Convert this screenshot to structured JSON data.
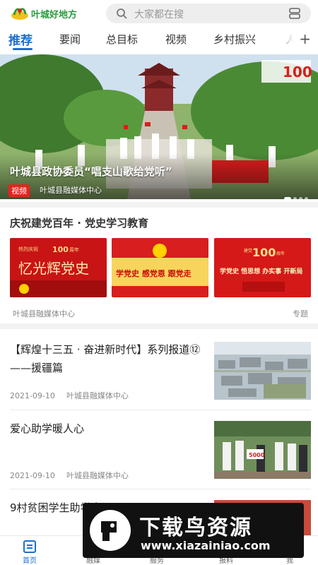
{
  "header": {
    "app_title": "叶城好地方",
    "search_placeholder": "大家都在搜"
  },
  "tabs": [
    {
      "label": "推荐",
      "active": true
    },
    {
      "label": "要闻"
    },
    {
      "label": "总目标"
    },
    {
      "label": "视频"
    },
    {
      "label": "乡村振兴"
    },
    {
      "label": "人"
    }
  ],
  "hero": {
    "caption": "叶城县政协委员“唱支山歌给党听”",
    "tag": "视频",
    "source": "叶城县融媒体中心",
    "badge_number": "100"
  },
  "special": {
    "title": "庆祝建党百年 · 党史学习教育",
    "source": "叶城县融媒体中心",
    "tag": "专题",
    "banners": [
      {
        "text": "忆光辉党史",
        "small": "热烈庆祝",
        "number": "100",
        "unit": "周年"
      },
      {
        "text": "学党史 感党恩 跟党走"
      },
      {
        "text": "学党史 悟思想 办实事 开新局",
        "small": "建党",
        "number": "100",
        "unit": "周年"
      }
    ]
  },
  "news": [
    {
      "title": "【辉煌十三五 · 奋进新时代】系列报道⑫——援疆篇",
      "date": "2021-09-10",
      "source": "叶城县融媒体中心"
    },
    {
      "title": "爱心助学暖人心",
      "date": "2021-09-10",
      "source": "叶城县融媒体中心",
      "banner_text": "5000"
    },
    {
      "title": "9村贫困学生助学金",
      "date": "",
      "source": ""
    }
  ],
  "bottom_nav": [
    {
      "label": "首页",
      "active": true
    },
    {
      "label": "融媒"
    },
    {
      "label": "服务"
    },
    {
      "label": "报料"
    },
    {
      "label": "我"
    }
  ],
  "watermark": {
    "text": "下载鸟资源",
    "url": "www.xiazainiao.com"
  },
  "colors": {
    "accent": "#1c6fd0",
    "brand_green": "#2a9b3d",
    "party_red": "#d81e1e"
  },
  "icons": [
    "logo-icon",
    "search-icon",
    "scan-icon",
    "add-icon",
    "home-icon",
    "media-icon",
    "service-icon",
    "report-icon",
    "user-icon"
  ]
}
